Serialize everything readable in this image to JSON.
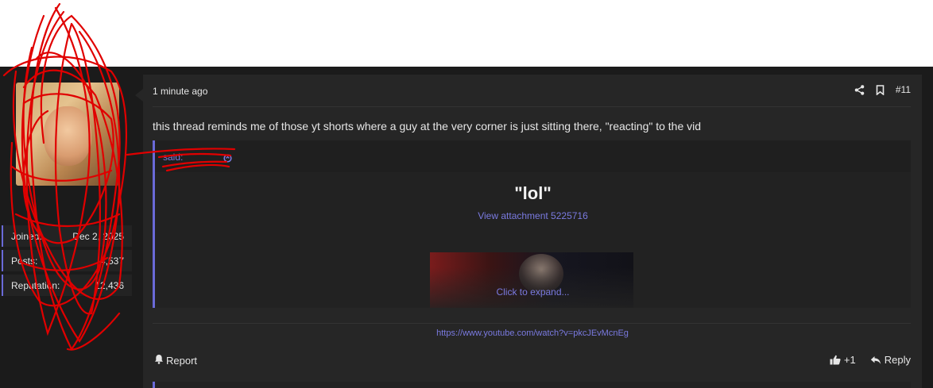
{
  "user": {
    "username": "",
    "title": "",
    "stats": [
      {
        "label": "Joined:",
        "value": "Dec 2, 2025"
      },
      {
        "label": "Posts:",
        "value": "4,537"
      },
      {
        "label": "Reputation:",
        "value": "12,436"
      }
    ]
  },
  "post": {
    "date": "1 minute ago",
    "number": "#11",
    "body": "this thread reminds me of those yt shorts where a guy at the very corner is just sitting there, \"reacting\" to the vid",
    "quote": {
      "author_suffix": "said:",
      "title": "\"lol\"",
      "attachment_link": "View attachment 5225716",
      "expand_label": "Click to expand..."
    },
    "link": "https://www.youtube.com/watch?v=pkcJEvMcnEg",
    "report_label": "Report",
    "like_count": "+1",
    "reply_label": "Reply"
  },
  "colors": {
    "accent": "#6a6ad8",
    "link": "#7a7ae0",
    "username": "#d9892b",
    "background": "#1b1b1b",
    "message_bg": "#262626",
    "scribble": "#e00000"
  },
  "icons": [
    "share-icon",
    "bookmark-icon",
    "quote-arrow-icon",
    "bell-icon",
    "thumbs-up-icon",
    "reply-icon"
  ]
}
